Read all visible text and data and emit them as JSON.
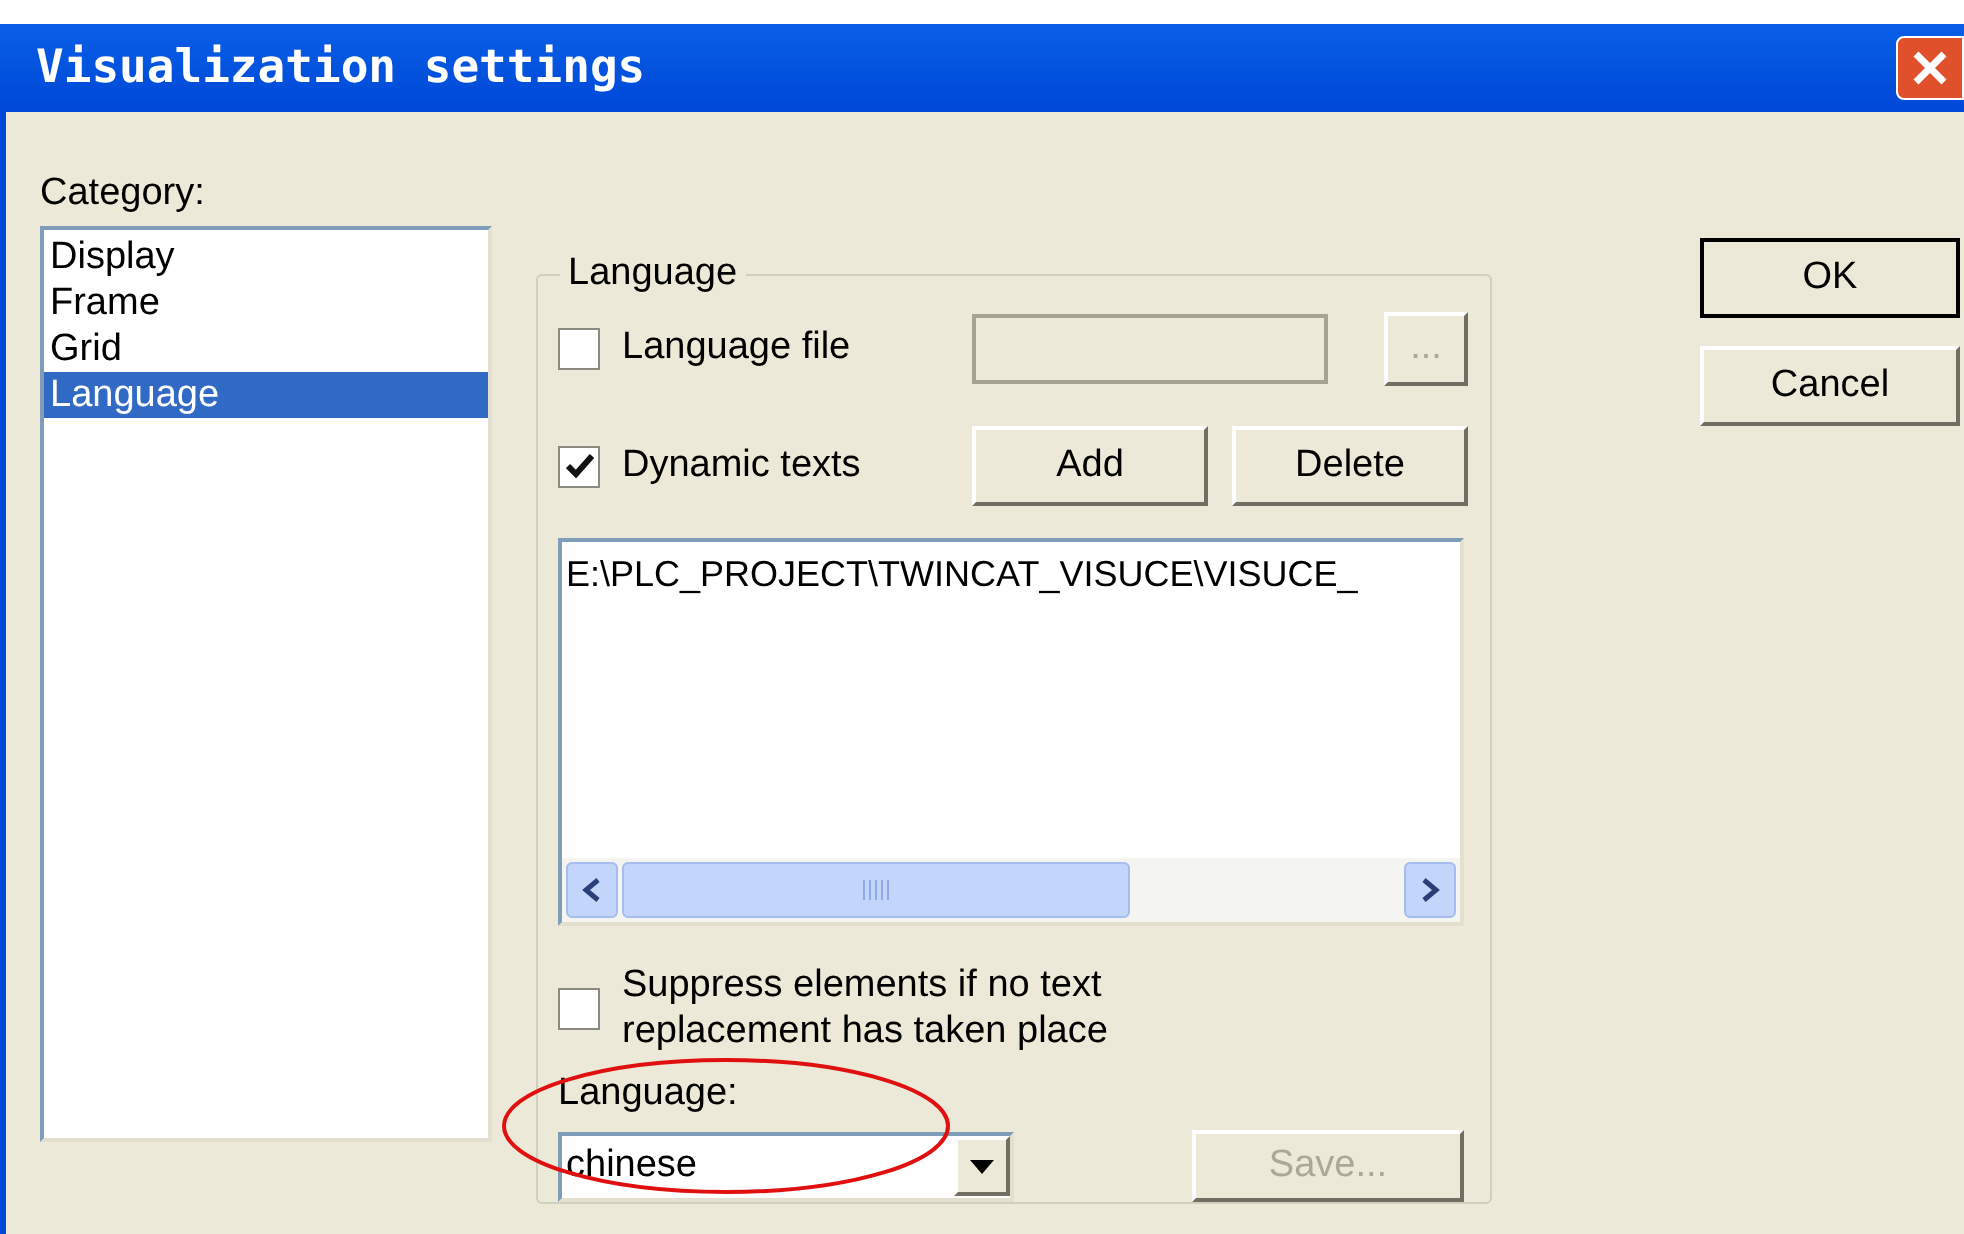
{
  "window": {
    "title": "Visualization settings"
  },
  "category": {
    "label": "Category:",
    "items": [
      {
        "label": "Display",
        "selected": false
      },
      {
        "label": "Frame",
        "selected": false
      },
      {
        "label": "Grid",
        "selected": false
      },
      {
        "label": "Language",
        "selected": true
      }
    ]
  },
  "group": {
    "title": "Language",
    "language_file": {
      "label": "Language file",
      "checked": false,
      "disabled": true,
      "browse": "..."
    },
    "dynamic_texts": {
      "label": "Dynamic texts",
      "checked": true,
      "add": "Add",
      "delete": "Delete"
    },
    "file_list": [
      "E:\\PLC_PROJECT\\TWINCAT_VISUCE\\VISUCE_"
    ],
    "suppress": {
      "label": "Suppress elements if no text replacement has taken place",
      "checked": false
    },
    "language": {
      "label": "Language:",
      "value": "chinese"
    },
    "save": {
      "label": "Save...",
      "disabled": true
    }
  },
  "buttons": [
    "OK",
    "Cancel"
  ]
}
